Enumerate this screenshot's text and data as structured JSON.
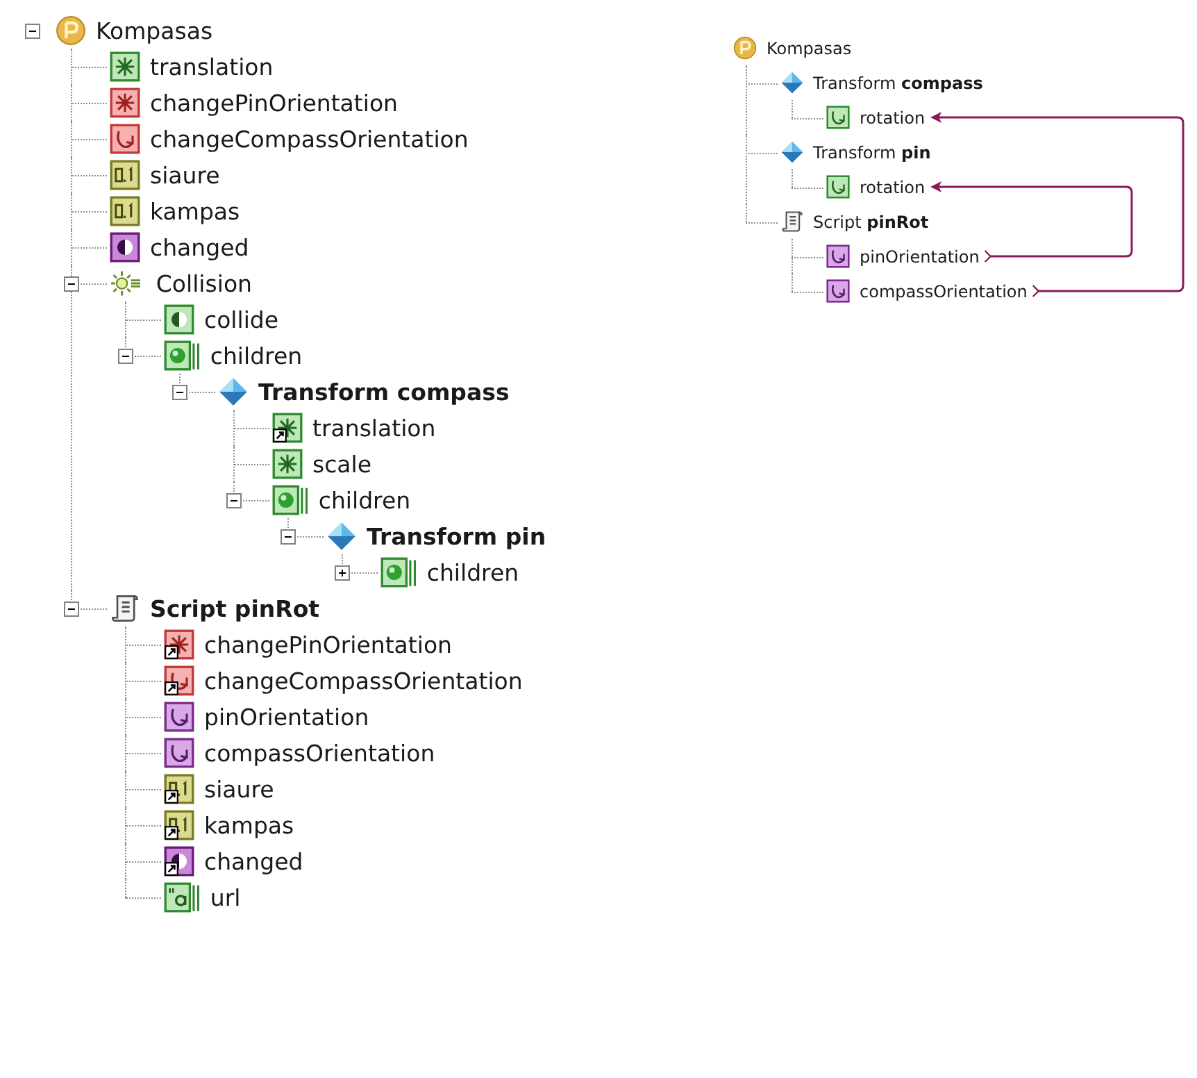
{
  "scene_tree": {
    "nodes": [
      {
        "label": "Kompasas",
        "kind": "proto",
        "bold": false,
        "linked": false,
        "expanded": true,
        "children": [
          {
            "label": "translation",
            "kind": "vec-green",
            "bold": false,
            "linked": false
          },
          {
            "label": "changePinOrientation",
            "kind": "vec-red",
            "bold": false,
            "linked": false
          },
          {
            "label": "changeCompassOrientation",
            "kind": "rot-red",
            "bold": false,
            "linked": false
          },
          {
            "label": "siaure",
            "kind": "float",
            "bold": false,
            "linked": false
          },
          {
            "label": "kampas",
            "kind": "float",
            "bold": false,
            "linked": false
          },
          {
            "label": "changed",
            "kind": "bool-purple",
            "bold": false,
            "linked": false
          },
          {
            "label": "Collision",
            "kind": "collision",
            "bold": false,
            "linked": false,
            "expanded": true,
            "children": [
              {
                "label": "collide",
                "kind": "bool-green",
                "bold": false,
                "linked": false
              },
              {
                "label": "children",
                "kind": "mfnode",
                "bold": false,
                "linked": false,
                "expanded": true,
                "children": [
                  {
                    "label": "Transform compass",
                    "kind": "transform",
                    "bold": true,
                    "linked": false,
                    "expanded": true,
                    "children": [
                      {
                        "label": "translation",
                        "kind": "vec-green",
                        "bold": false,
                        "linked": true
                      },
                      {
                        "label": "scale",
                        "kind": "vec-green",
                        "bold": false,
                        "linked": false
                      },
                      {
                        "label": "children",
                        "kind": "mfnode",
                        "bold": false,
                        "linked": false,
                        "expanded": true,
                        "children": [
                          {
                            "label": "Transform pin",
                            "kind": "transform",
                            "bold": true,
                            "linked": false,
                            "expanded": true,
                            "children": [
                              {
                                "label": "children",
                                "kind": "mfnode",
                                "bold": false,
                                "linked": false,
                                "expanded": false
                              }
                            ]
                          }
                        ]
                      }
                    ]
                  }
                ]
              }
            ]
          },
          {
            "label": "Script pinRot",
            "kind": "script",
            "bold": true,
            "linked": false,
            "expanded": true,
            "children": [
              {
                "label": "changePinOrientation",
                "kind": "vec-red",
                "bold": false,
                "linked": true
              },
              {
                "label": "changeCompassOrientation",
                "kind": "rot-red",
                "bold": false,
                "linked": true
              },
              {
                "label": "pinOrientation",
                "kind": "rot-purple",
                "bold": false,
                "linked": false
              },
              {
                "label": "compassOrientation",
                "kind": "rot-purple",
                "bold": false,
                "linked": false
              },
              {
                "label": "siaure",
                "kind": "float",
                "bold": false,
                "linked": true
              },
              {
                "label": "kampas",
                "kind": "float",
                "bold": false,
                "linked": true
              },
              {
                "label": "changed",
                "kind": "bool-purple",
                "bold": false,
                "linked": true
              },
              {
                "label": "url",
                "kind": "string",
                "bold": false,
                "linked": false
              }
            ]
          }
        ]
      }
    ]
  },
  "route_tree": {
    "nodes": [
      {
        "label": "Kompasas",
        "kind": "proto",
        "children": [
          {
            "label": "Transform **compass**",
            "kind": "transform",
            "children": [
              {
                "label": "rotation",
                "kind": "rot-green",
                "route_in": true
              }
            ]
          },
          {
            "label": "Transform **pin**",
            "kind": "transform",
            "children": [
              {
                "label": "rotation",
                "kind": "rot-green",
                "route_in": true
              }
            ]
          },
          {
            "label": "Script **pinRot**",
            "kind": "script",
            "children": [
              {
                "label": "pinOrientation",
                "kind": "rot-purple",
                "route_out": true
              },
              {
                "label": "compassOrientation",
                "kind": "rot-purple",
                "route_out": true
              }
            ]
          }
        ]
      }
    ]
  }
}
